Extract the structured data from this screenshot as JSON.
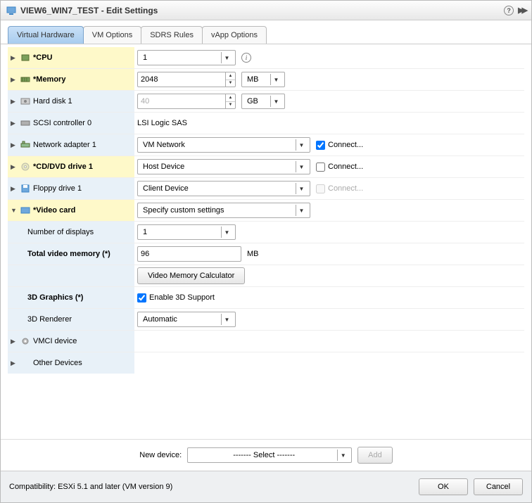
{
  "title": "VIEW6_WIN7_TEST - Edit Settings",
  "tabs": [
    "Virtual Hardware",
    "VM Options",
    "SDRS Rules",
    "vApp Options"
  ],
  "rows": {
    "cpu": {
      "label": "*CPU",
      "value": "1"
    },
    "memory": {
      "label": "*Memory",
      "value": "2048",
      "unit": "MB"
    },
    "harddisk": {
      "label": "Hard disk 1",
      "value": "40",
      "unit": "GB"
    },
    "scsi": {
      "label": "SCSI controller 0",
      "value": "LSI Logic SAS"
    },
    "network": {
      "label": "Network adapter 1",
      "value": "VM Network",
      "connect": "Connect..."
    },
    "cddvd": {
      "label": "*CD/DVD drive 1",
      "value": "Host Device",
      "connect": "Connect..."
    },
    "floppy": {
      "label": "Floppy drive 1",
      "value": "Client Device",
      "connect": "Connect..."
    },
    "video": {
      "label": "*Video card",
      "value": "Specify custom settings"
    },
    "displays": {
      "label": "Number of displays",
      "value": "1"
    },
    "videomem": {
      "label": "Total video memory (*)",
      "value": "96",
      "unit": "MB"
    },
    "calc": {
      "label": "Video Memory Calculator"
    },
    "graphics3d": {
      "label": "3D Graphics (*)",
      "checkbox": "Enable 3D Support"
    },
    "renderer": {
      "label": "3D Renderer",
      "value": "Automatic"
    },
    "vmci": {
      "label": "VMCI device"
    },
    "other": {
      "label": "Other Devices"
    }
  },
  "newdevice": {
    "label": "New device:",
    "select": "------- Select -------",
    "add": "Add"
  },
  "footer": {
    "compat": "Compatibility: ESXi 5.1 and later (VM version 9)",
    "ok": "OK",
    "cancel": "Cancel"
  }
}
